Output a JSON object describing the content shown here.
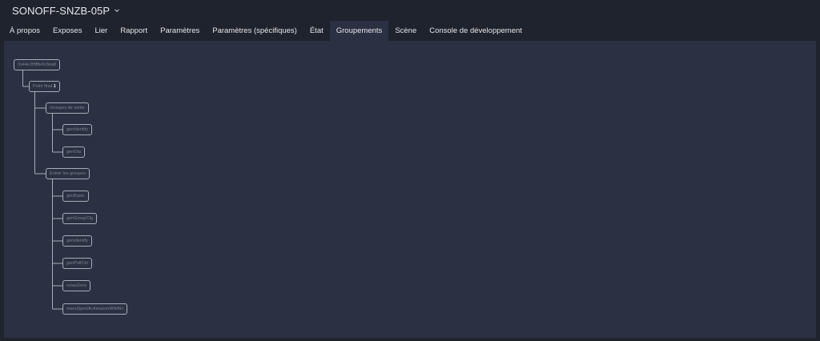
{
  "header": {
    "device_title": "SONOFF-SNZB-05P"
  },
  "tabs": [
    {
      "label": "À propos"
    },
    {
      "label": "Exposes"
    },
    {
      "label": "Lier"
    },
    {
      "label": "Rapport"
    },
    {
      "label": "Paramètres"
    },
    {
      "label": "Paramètres (spécifiques)"
    },
    {
      "label": "État"
    },
    {
      "label": "Groupements"
    },
    {
      "label": "Scène"
    },
    {
      "label": "Console de développement"
    }
  ],
  "active_tab": "Groupements",
  "tree": {
    "root": "0x44e2f8fffe0c8ea8",
    "endpoint_label": "Point final",
    "endpoint_number": "1",
    "output_group_label": "Groupes de sortie",
    "output_clusters": [
      "genIdentify",
      "genOta"
    ],
    "input_group_label": "Entrer les groupes",
    "input_clusters": [
      "genBasic",
      "genGroupCfg",
      "genIdentify",
      "genPollCtrl",
      "ssIasZone",
      "manuSpecificAmazonWWAH"
    ]
  }
}
